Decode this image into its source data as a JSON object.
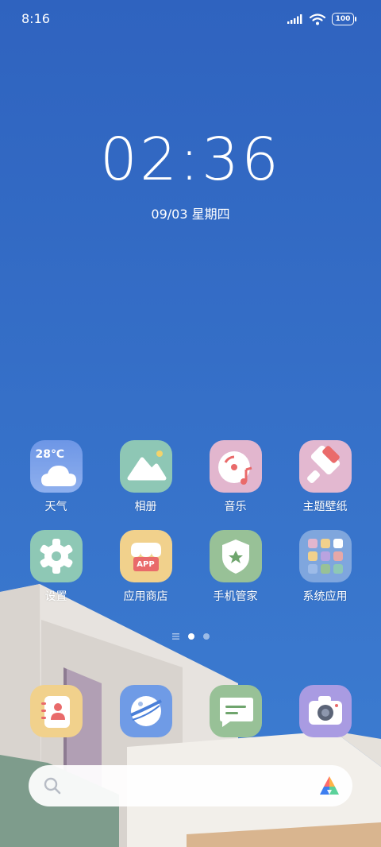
{
  "status_bar": {
    "time": "8:16",
    "battery": "100"
  },
  "lock_clock": {
    "time": "02:36",
    "date": "09/03 星期四"
  },
  "weather_badge": "28℃",
  "apps": [
    {
      "label": "天气",
      "icon": "weather-icon"
    },
    {
      "label": "相册",
      "icon": "gallery-icon"
    },
    {
      "label": "音乐",
      "icon": "music-icon"
    },
    {
      "label": "主题壁纸",
      "icon": "themes-icon"
    },
    {
      "label": "设置",
      "icon": "settings-icon"
    },
    {
      "label": "应用商店",
      "icon": "app-store-icon"
    },
    {
      "label": "手机管家",
      "icon": "security-icon"
    },
    {
      "label": "系统应用",
      "icon": "folder-icon"
    }
  ],
  "app_store_badge": "APP",
  "page_indicator": {
    "pages": 2,
    "current": 1
  },
  "dock": [
    {
      "icon": "contacts-icon"
    },
    {
      "icon": "browser-icon"
    },
    {
      "icon": "messages-icon"
    },
    {
      "icon": "camera-icon"
    }
  ],
  "search_bar": {
    "icon": "search-icon",
    "assistant_icon": "assistant-icon"
  },
  "colors": {
    "sky_top": "#2f64c1",
    "sky_bottom": "#3a7bd0"
  }
}
